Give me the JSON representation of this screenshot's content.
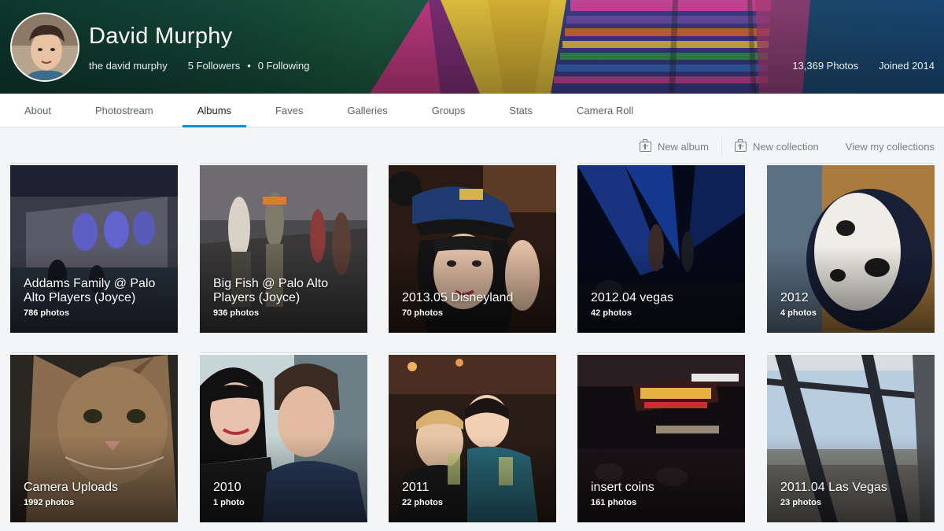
{
  "profile": {
    "name": "David Murphy",
    "username": "the david murphy",
    "followers": "5 Followers",
    "dot": "•",
    "following": "0 Following",
    "photos": "13,369 Photos",
    "joined": "Joined 2014"
  },
  "tabs": [
    "About",
    "Photostream",
    "Albums",
    "Faves",
    "Galleries",
    "Groups",
    "Stats",
    "Camera Roll"
  ],
  "active_tab": "Albums",
  "toolbar": {
    "new_album": "New album",
    "new_collection": "New collection",
    "view_collections": "View my collections"
  },
  "albums": [
    {
      "title": "Addams Family @ Palo Alto Players (Joyce)",
      "count": "786 photos",
      "scene": "stage"
    },
    {
      "title": "Big Fish @ Palo Alto Players (Joyce)",
      "count": "936 photos",
      "scene": "theater"
    },
    {
      "title": "2013.05 Disneyland",
      "count": "70 photos",
      "scene": "portrait-hat"
    },
    {
      "title": "2012.04 vegas",
      "count": "42 photos",
      "scene": "concert"
    },
    {
      "title": "2012",
      "count": "4 photos",
      "scene": "cat-sleeping"
    },
    {
      "title": "Camera Uploads",
      "count": "1992 photos",
      "scene": "tabby-cat"
    },
    {
      "title": "2010",
      "count": "1 photo",
      "scene": "couple"
    },
    {
      "title": "2011",
      "count": "22 photos",
      "scene": "party"
    },
    {
      "title": "insert coins",
      "count": "161 photos",
      "scene": "neon-sign"
    },
    {
      "title": "2011.04 Las Vegas",
      "count": "23 photos",
      "scene": "window-view"
    }
  ],
  "colors": {
    "accent": "#128fdc",
    "page_bg": "#f3f5f6",
    "text": "#212124",
    "muted": "#7a8186"
  },
  "icons": [
    "add-album-icon",
    "add-collection-icon"
  ]
}
